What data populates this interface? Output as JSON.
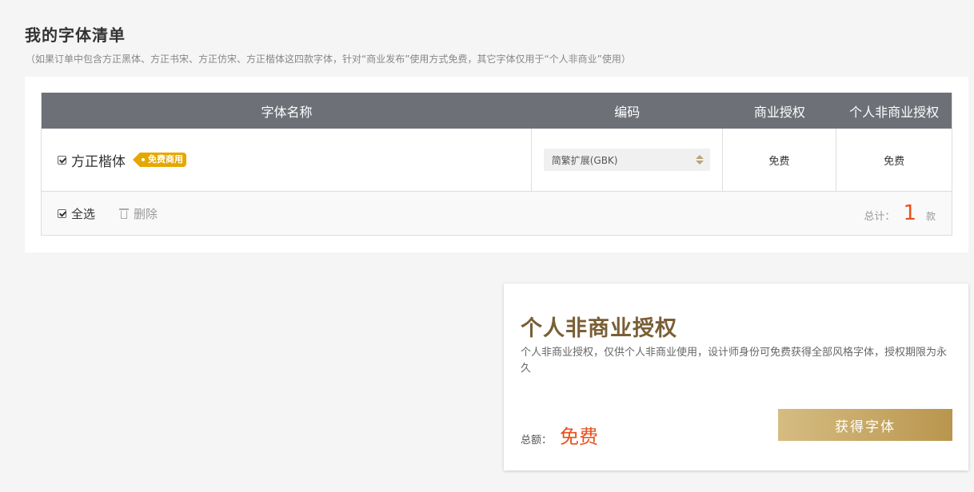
{
  "header": {
    "title": "我的字体清单",
    "note": "（如果订单中包含方正黑体、方正书宋、方正仿宋、方正楷体这四款字体，针对“商业发布”使用方式免费，其它字体仅用于“个人非商业”使用）"
  },
  "table": {
    "columns": [
      "字体名称",
      "编码",
      "商业授权",
      "个人非商业授权"
    ],
    "rows": [
      {
        "name": "方正楷体",
        "tag": "免费商用",
        "encoding": "简繁扩展(GBK)",
        "commercial": "免费",
        "personal": "免费",
        "checked": true
      }
    ],
    "footer": {
      "select_all": "全选",
      "delete": "删除",
      "total_label": "总计：",
      "total_count": "1",
      "unit": "款"
    }
  },
  "license": {
    "title": "个人非商业授权",
    "description": "个人非商业授权，仅供个人非商业使用，设计师身份可免费获得全部风格字体，授权期限为永久",
    "amount_label": "总额：",
    "amount_value": "免费",
    "button": "获得字体"
  },
  "colors": {
    "header_bg": "#6e7078",
    "accent_red": "#e8501b",
    "gold": "#b9964e",
    "tag": "#e6a700"
  }
}
